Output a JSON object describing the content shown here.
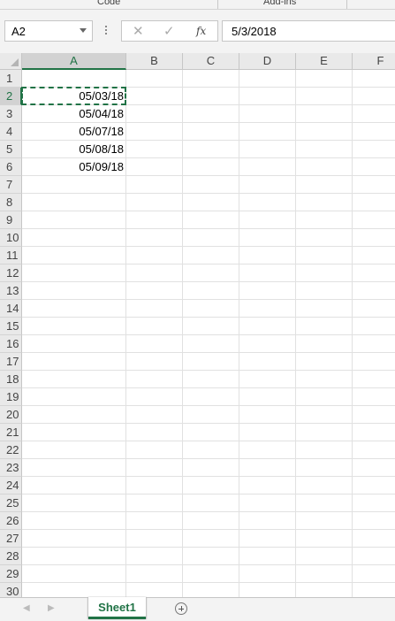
{
  "ribbon": {
    "groups": [
      "Code",
      "Add-ins"
    ]
  },
  "formula_bar": {
    "name_box": "A2",
    "cancel_icon": "✕",
    "enter_icon": "✓",
    "fx_label": "fx",
    "formula": "5/3/2018"
  },
  "grid": {
    "columns": [
      "A",
      "B",
      "C",
      "D",
      "E",
      "F"
    ],
    "rows": [
      "1",
      "2",
      "3",
      "4",
      "5",
      "6",
      "7",
      "8",
      "9",
      "10",
      "11",
      "12",
      "13",
      "14",
      "15",
      "16",
      "17",
      "18",
      "19",
      "20",
      "21",
      "22",
      "23",
      "24",
      "25",
      "26",
      "27",
      "28",
      "29",
      "30"
    ],
    "cells": {
      "A2": "05/03/18",
      "A3": "05/04/18",
      "A4": "05/07/18",
      "A5": "05/08/18",
      "A6": "05/09/18"
    },
    "active_cell": "A2"
  },
  "sheets": {
    "tabs": [
      "Sheet1"
    ],
    "active": "Sheet1",
    "prev_icon": "◀",
    "next_icon": "▶"
  },
  "colors": {
    "accent": "#217346",
    "header_bg": "#e9e9e9",
    "gridline": "#e1e1e1"
  }
}
